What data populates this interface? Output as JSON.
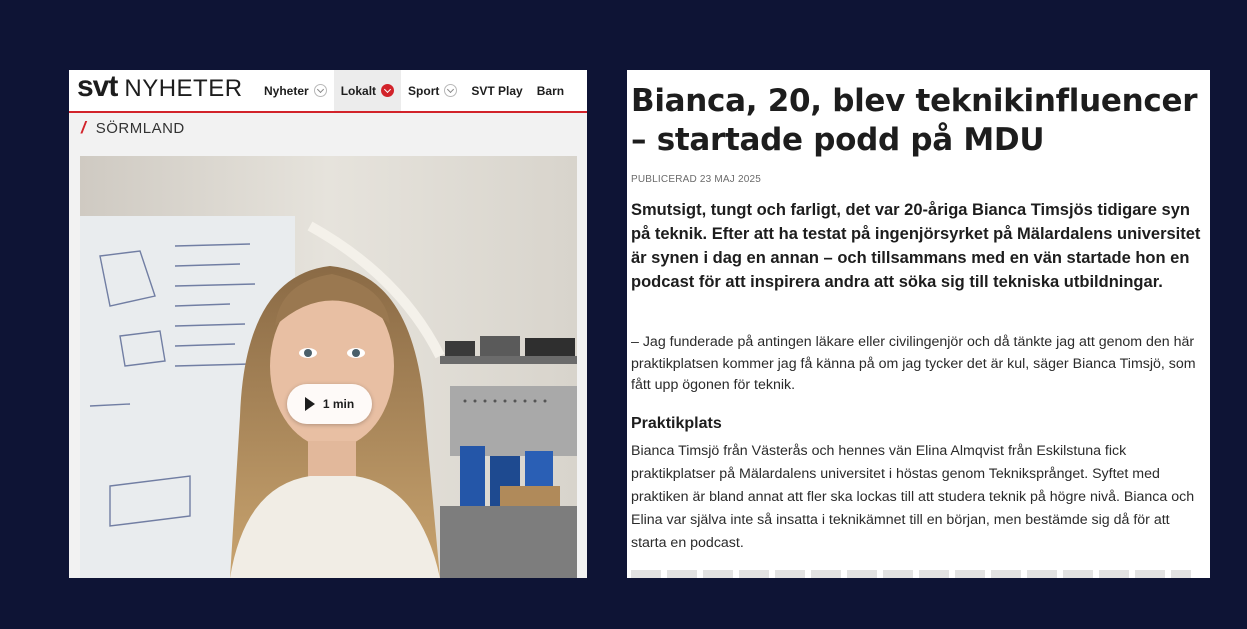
{
  "svt": {
    "logo_brand": "svt",
    "logo_section": "NYHETER",
    "nav": [
      {
        "label": "Nyheter",
        "active": false
      },
      {
        "label": "Lokalt",
        "active": true
      },
      {
        "label": "Sport",
        "active": false
      },
      {
        "label": "SVT Play"
      },
      {
        "label": "Barn"
      }
    ],
    "region": "SÖRMLAND",
    "video": {
      "duration_label": "1 min"
    }
  },
  "article": {
    "headline": "Bianca, 20, blev teknikinfluencer – startade podd på MDU",
    "published": "PUBLICERAD 23 MAJ 2025",
    "lead": "Smutsigt, tungt och farligt, det var 20-åriga Bianca Timsjös tidigare syn på teknik. Efter att ha testat på ingenjörsyrket på Mälardalens universitet är synen i dag en annan – och tillsammans med en vän startade hon en podcast för att inspirera andra att söka sig till tekniska utbildningar.",
    "quote": "– Jag funderade på antingen läkare eller civilingenjör och då tänkte jag att genom den här praktikplatsen kommer jag få känna på om jag tycker det är kul, säger Bianca Timsjö, som fått upp ögonen för teknik.",
    "subheading": "Praktikplats",
    "body": "Bianca Timsjö från Västerås och hennes vän Elina Almqvist från Eskilstuna fick praktikplatser på Mälardalens universitet i höstas genom Tekniksprånget. Syftet med praktiken är bland annat att fler ska lockas till att studera teknik på högre nivå. Bianca och Elina var själva inte så insatta i teknikämnet till en början, men bestämde sig då för att starta en podcast."
  },
  "colors": {
    "background": "#0e1435",
    "svt_red": "#d2232a"
  }
}
